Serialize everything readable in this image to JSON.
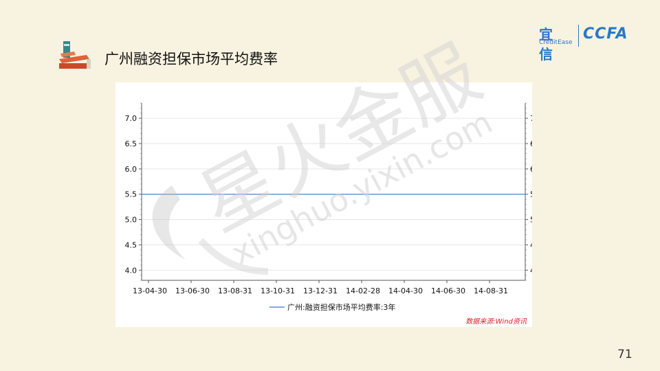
{
  "slide": {
    "title": "广州融资担保市场平均费率",
    "page_number": "71"
  },
  "logo": {
    "brand_cn": "宜信",
    "brand_en": "CreditEase",
    "partner": "CCFA"
  },
  "watermark": {
    "text_cn": "星火金服",
    "url": "xinghuo.yixin.com"
  },
  "colors": {
    "series_line": "#5b8ec7",
    "source_text": "#e0202a",
    "background": "#f8f3e0"
  },
  "chart_data": {
    "type": "line",
    "categories": [
      "13-04-30",
      "13-06-30",
      "13-08-31",
      "13-10-31",
      "13-12-31",
      "14-02-28",
      "14-04-30",
      "14-06-30",
      "14-08-31"
    ],
    "series": [
      {
        "name": "广州:融资担保市场平均费率:3年",
        "values": [
          5.5,
          5.5,
          5.5,
          5.5,
          5.5,
          5.5,
          5.5,
          5.5,
          5.5
        ]
      }
    ],
    "y_ticks": [
      "4.0",
      "4.5",
      "5.0",
      "5.5",
      "6.0",
      "6.5",
      "7.0"
    ],
    "ylim": [
      3.8,
      7.3
    ],
    "secondary_y_axis": true,
    "grid": "horizontal",
    "legend_position": "bottom-center",
    "source": "数据来源:Wind资讯"
  }
}
